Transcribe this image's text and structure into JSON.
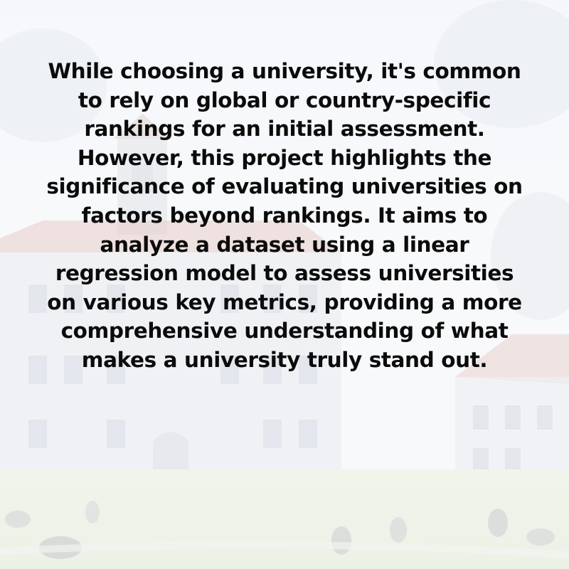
{
  "body_text": "While choosing a university, it's common to rely on global or country-specific rankings for an initial assessment. However, this project highlights the significance of evaluating universities on factors beyond rankings. It aims to analyze a dataset using a linear regression model to assess universities on various key metrics, providing a more comprehensive understanding of what makes a university truly stand out.",
  "colors": {
    "text": "#0b0b0b",
    "brick_roof": "#c98f86",
    "stone_wall": "#d9dce3",
    "sky": "#eef1f6",
    "lawn": "#d6e0c8"
  }
}
